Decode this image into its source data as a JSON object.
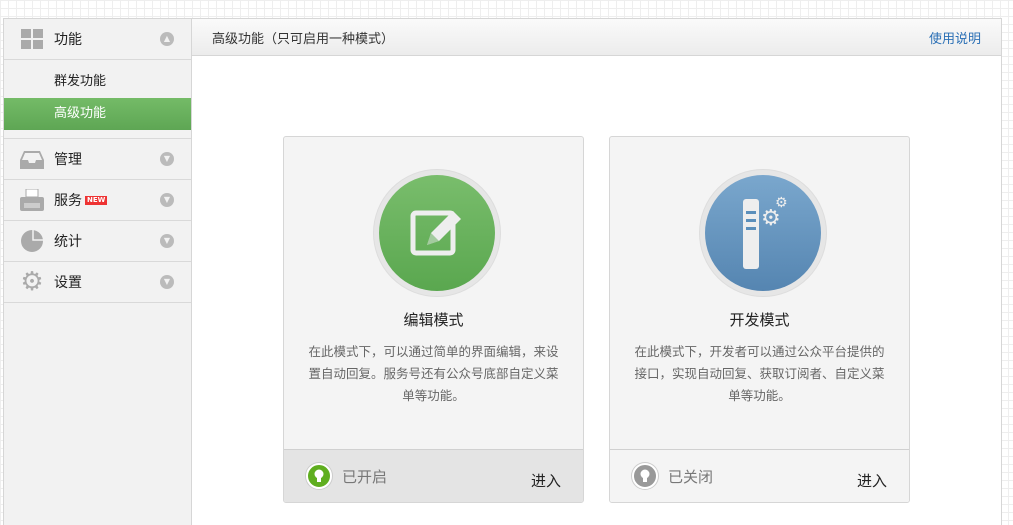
{
  "sidebar": {
    "groups": [
      {
        "label": "功能",
        "icon": "grid-icon",
        "expanded": true,
        "items": [
          {
            "label": "群发功能",
            "active": false
          },
          {
            "label": "高级功能",
            "active": true
          }
        ]
      },
      {
        "label": "管理",
        "icon": "inbox-icon"
      },
      {
        "label": "服务",
        "icon": "printer-icon",
        "badge": "NEW"
      },
      {
        "label": "统计",
        "icon": "pie-chart-icon"
      },
      {
        "label": "设置",
        "icon": "gear-icon"
      }
    ]
  },
  "header": {
    "title": "高级功能（只可启用一种模式）",
    "help_link": "使用说明"
  },
  "cards": [
    {
      "title": "编辑模式",
      "desc": "在此模式下，可以通过简单的界面编辑，来设置自动回复。服务号还有公众号底部自定义菜单等功能。",
      "status": "已开启",
      "enter": "进入",
      "color": "#5fac54"
    },
    {
      "title": "开发模式",
      "desc": "在此模式下，开发者可以通过公众平台提供的接口，实现自动回复、获取订阅者、自定义菜单等功能。",
      "status": "已关闭",
      "enter": "进入",
      "color": "#5b8fbb"
    }
  ]
}
